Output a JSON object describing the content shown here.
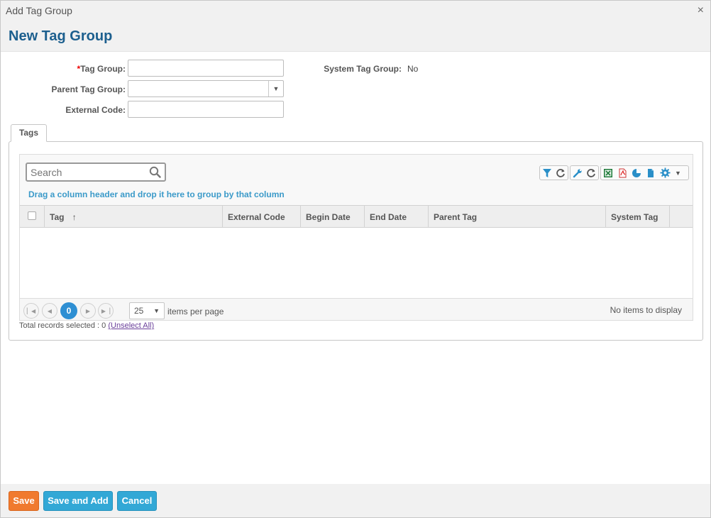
{
  "window": {
    "title": "Add Tag Group",
    "close_glyph": "×"
  },
  "header": {
    "title": "New Tag Group"
  },
  "form": {
    "tag_group": {
      "required_marker": "*",
      "label": "Tag Group:",
      "value": ""
    },
    "parent_tag_group": {
      "label": "Parent Tag Group:",
      "value": ""
    },
    "external_code": {
      "label": "External Code:",
      "value": ""
    },
    "system_tag_group": {
      "label": "System Tag Group:",
      "value": "No"
    }
  },
  "tabs": [
    {
      "label": "Tags"
    }
  ],
  "grid": {
    "search_placeholder": "Search",
    "group_hint": "Drag a column header and drop it here to group by that column",
    "toolbar_icons": [
      "filter-icon",
      "refresh-icon",
      "wrench-icon",
      "refresh-icon",
      "excel-icon",
      "pdf-icon",
      "chart-icon",
      "document-icon",
      "gear-icon"
    ],
    "columns": [
      "Tag",
      "External Code",
      "Begin Date",
      "End Date",
      "Parent Tag",
      "System Tag"
    ],
    "sort_indicator": "↑",
    "rows": [],
    "pager": {
      "current_page": "0",
      "page_size": "25",
      "items_per_page_label": "items per page",
      "status": "No items to display"
    }
  },
  "selection": {
    "text": "Total records selected : 0",
    "unselect_label": "(Unselect All)"
  },
  "footer": {
    "save": "Save",
    "save_and_add": "Save and Add",
    "cancel": "Cancel"
  },
  "colors": {
    "title_blue": "#1c5f8e",
    "save_orange": "#f07a2e",
    "action_blue": "#32a8d6",
    "pager_active": "#2e8fd3",
    "hint_blue": "#3b9ac9"
  }
}
